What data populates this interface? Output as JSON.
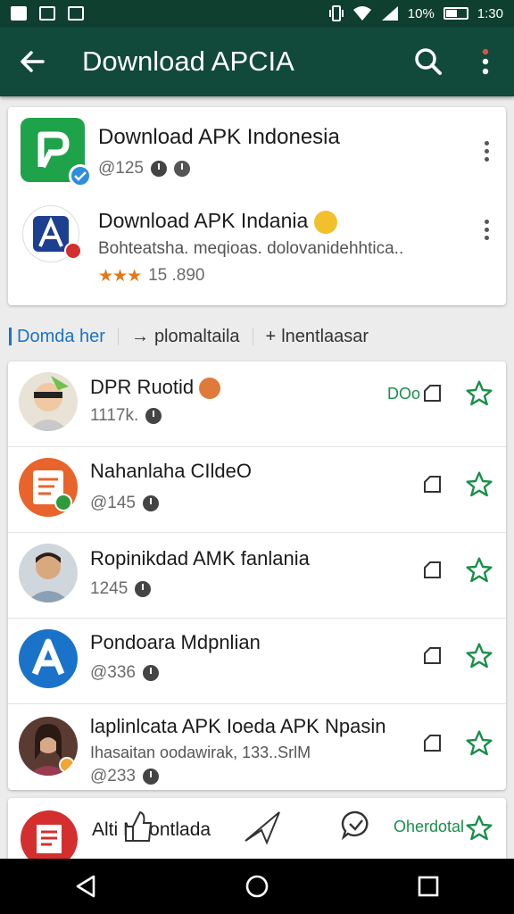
{
  "status": {
    "time": "1:30",
    "battery": "10%"
  },
  "appbar": {
    "title": "Download APCIA"
  },
  "featured": [
    {
      "name": "Download APK Indonesia",
      "meta": "@125"
    },
    {
      "name": "Download APK Indania",
      "desc": "Bohteatsha. meqioas. dolovanidehhtica..",
      "rating_text": "15 .890"
    }
  ],
  "tabs": [
    "Domda her",
    "plomaltaila",
    "lnentlaasar"
  ],
  "rows": [
    {
      "name": "DPR Ruotid",
      "meta": "1117k.",
      "download_label": "DOo"
    },
    {
      "name": "Nahanlaha CIldeO",
      "meta": "@145"
    },
    {
      "name": "Ropinikdad AMK fanlania",
      "meta": "1245"
    },
    {
      "name": "Pondoara Mdpnlian",
      "meta": "@336"
    },
    {
      "name": "laplinlcata APK Ioeda APK Npasin",
      "sub": "Ihasaitan oodawirak, 133..SrlM",
      "meta": "@233"
    }
  ],
  "partial": {
    "name": "Alti Mhontlada",
    "download_label": "Oherdotal"
  },
  "colors": {
    "appbar": "#11493a",
    "statusbar": "#0f3f2f",
    "accent_green": "#1a8f4a",
    "accent_blue": "#1a73c8",
    "star_orange": "#e57817"
  }
}
